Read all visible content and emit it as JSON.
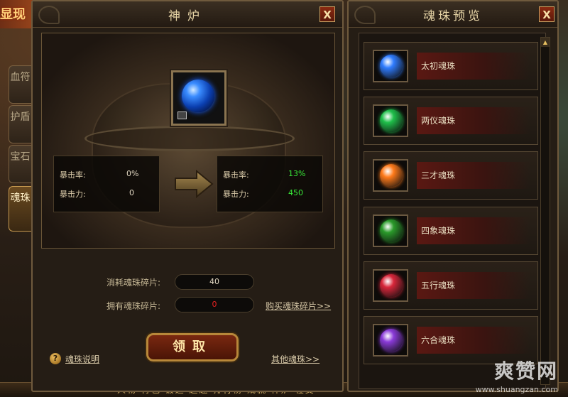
{
  "background": {
    "title_fragment": "显现",
    "bottom_bar_text": "人物  背包  锻造  超越  排行榜  成就  神炉  社交",
    "watermark": "爽赞网",
    "watermark_url": "www.shuangzan.com"
  },
  "side_tabs": [
    {
      "label": "血符",
      "active": false
    },
    {
      "label": "护盾",
      "active": false
    },
    {
      "label": "宝石",
      "active": false
    },
    {
      "label": "魂珠",
      "active": true
    }
  ],
  "furnace": {
    "title": "神炉",
    "close_label": "X",
    "left_stats": [
      {
        "label": "暴击率:",
        "value": "0%"
      },
      {
        "label": "暴击力:",
        "value": "0"
      }
    ],
    "right_stats": [
      {
        "label": "暴击率:",
        "value": "13%"
      },
      {
        "label": "暴击力:",
        "value": "450"
      }
    ],
    "consume_label": "消耗魂珠碎片:",
    "consume_value": "40",
    "own_label": "拥有魂珠碎片:",
    "own_value": "0",
    "buy_link": "购买魂珠碎片>>",
    "claim_button": "领取",
    "help_link": "魂珠说明",
    "other_link": "其他魂珠>>",
    "colors": {
      "highlight": "#38e838",
      "warning": "#e82020"
    }
  },
  "preview": {
    "title": "魂珠预览",
    "close_label": "X",
    "items": [
      {
        "name": "太初魂珠",
        "icon": "blue-orb-icon",
        "color": "#2f7cff"
      },
      {
        "name": "两仪魂珠",
        "icon": "green-orb-icon",
        "color": "#1fbf4a"
      },
      {
        "name": "三才魂珠",
        "icon": "orange-orb-icon",
        "color": "#ff7a1a"
      },
      {
        "name": "四象魂珠",
        "icon": "dark-green-orb-icon",
        "color": "#2a9a2a"
      },
      {
        "name": "五行魂珠",
        "icon": "red-orb-icon",
        "color": "#d8263a"
      },
      {
        "name": "六合魂珠",
        "icon": "purple-orb-icon",
        "color": "#8a3ad8"
      }
    ]
  }
}
